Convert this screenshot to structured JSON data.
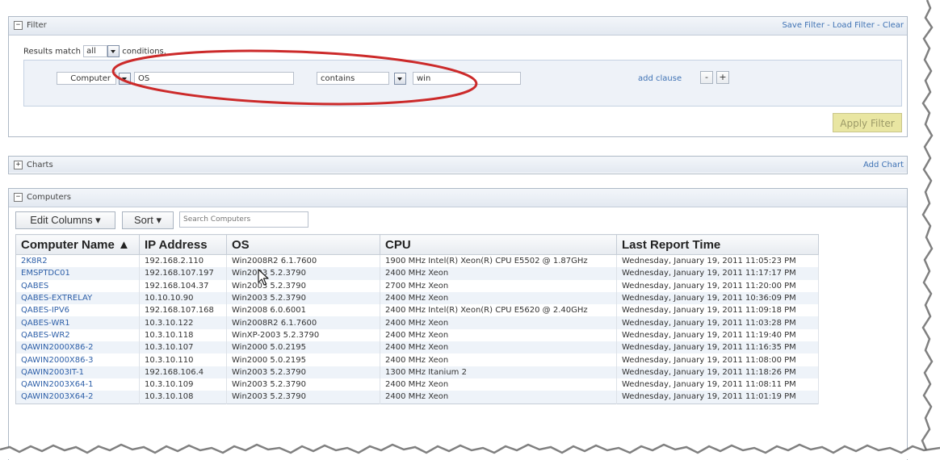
{
  "filter": {
    "title": "Filter",
    "toggle": "−",
    "save": "Save Filter",
    "load": "Load Filter",
    "clear": "Clear",
    "dash": "-",
    "match_prefix": "Results match",
    "match_value": "all",
    "match_suffix": "conditions.",
    "clause": {
      "field": "Computer",
      "attribute": "OS",
      "operator": "contains",
      "value": "win"
    },
    "add_clause": "add clause",
    "minus": "-",
    "plus": "+",
    "apply": "Apply Filter"
  },
  "charts": {
    "title": "Charts",
    "toggle": "+",
    "add": "Add Chart"
  },
  "computers": {
    "title": "Computers",
    "toggle": "−",
    "edit_columns": "Edit Columns ▾",
    "sort": "Sort ▾",
    "search_placeholder": "Search Computers",
    "columns": [
      "Computer Name",
      "IP Address",
      "OS",
      "CPU",
      "Last Report Time"
    ],
    "sort_indicator": "▲",
    "rows": [
      [
        "2K8R2",
        "192.168.2.110",
        "Win2008R2 6.1.7600",
        "1900 MHz Intel(R) Xeon(R) CPU E5502 @ 1.87GHz",
        "Wednesday, January 19, 2011 11:05:23 PM"
      ],
      [
        "EMSPTDC01",
        "192.168.107.197",
        "Win2003 5.2.3790",
        "2400 MHz Xeon",
        "Wednesday, January 19, 2011 11:17:17 PM"
      ],
      [
        "QABES",
        "192.168.104.37",
        "Win2003 5.2.3790",
        "2700 MHz Xeon",
        "Wednesday, January 19, 2011 11:20:00 PM"
      ],
      [
        "QABES-EXTRELAY",
        "10.10.10.90",
        "Win2003 5.2.3790",
        "2400 MHz Xeon",
        "Wednesday, January 19, 2011 10:36:09 PM"
      ],
      [
        "QABES-IPV6",
        "192.168.107.168",
        "Win2008 6.0.6001",
        "2400 MHz Intel(R) Xeon(R) CPU E5620 @ 2.40GHz",
        "Wednesday, January 19, 2011 11:09:18 PM"
      ],
      [
        "QABES-WR1",
        "10.3.10.122",
        "Win2008R2 6.1.7600",
        "2400 MHz Xeon",
        "Wednesday, January 19, 2011 11:03:28 PM"
      ],
      [
        "QABES-WR2",
        "10.3.10.118",
        "WinXP-2003 5.2.3790",
        "2400 MHz Xeon",
        "Wednesday, January 19, 2011 11:19:40 PM"
      ],
      [
        "QAWIN2000X86-2",
        "10.3.10.107",
        "Win2000 5.0.2195",
        "2400 MHz Xeon",
        "Wednesday, January 19, 2011 11:16:35 PM"
      ],
      [
        "QAWIN2000X86-3",
        "10.3.10.110",
        "Win2000 5.0.2195",
        "2400 MHz Xeon",
        "Wednesday, January 19, 2011 11:08:00 PM"
      ],
      [
        "QAWIN2003IT-1",
        "192.168.106.4",
        "Win2003 5.2.3790",
        "1300 MHz Itanium 2",
        "Wednesday, January 19, 2011 11:18:26 PM"
      ],
      [
        "QAWIN2003X64-1",
        "10.3.10.109",
        "Win2003 5.2.3790",
        "2400 MHz Xeon",
        "Wednesday, January 19, 2011 11:08:11 PM"
      ],
      [
        "QAWIN2003X64-2",
        "10.3.10.108",
        "Win2003 5.2.3790",
        "2400 MHz Xeon",
        "Wednesday, January 19, 2011 11:01:19 PM"
      ]
    ]
  },
  "colors": {
    "annotation": "#cc2a2a",
    "link": "#3f72b4",
    "apply_button": "#e9e6a2"
  }
}
